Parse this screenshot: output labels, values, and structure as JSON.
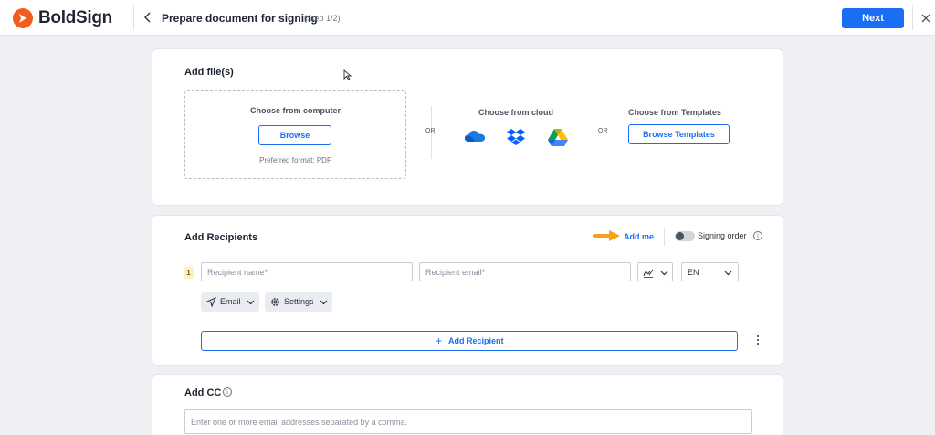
{
  "header": {
    "brand": "BoldSign",
    "title": "Prepare document for signing",
    "step": "(Step 1/2)",
    "next_label": "Next"
  },
  "files": {
    "title": "Add file(s)",
    "computer_title": "Choose from computer",
    "browse_label": "Browse",
    "preferred_format": "Preferred format: PDF",
    "or_label": "OR",
    "cloud_title": "Choose from cloud",
    "cloud_services": [
      "onedrive-icon",
      "dropbox-icon",
      "google-drive-icon"
    ],
    "templates_title": "Choose from Templates",
    "browse_templates_label": "Browse Templates"
  },
  "recipients": {
    "title": "Add Recipients",
    "add_me_label": "Add me",
    "signing_order_label": "Signing order",
    "signing_order_enabled": false,
    "rows": [
      {
        "number": "1",
        "name_placeholder": "Recipient name*",
        "email_placeholder": "Recipient email*",
        "role_icon": "signer-icon",
        "language": "EN",
        "delivery_label": "Email",
        "settings_label": "Settings"
      }
    ],
    "add_recipient_label": "Add Recipient"
  },
  "cc": {
    "title": "Add CC",
    "placeholder": "Enter one or more email addresses separated by a comma."
  },
  "colors": {
    "accent": "#1a6ef5",
    "brand": "#f25c1e",
    "annotation_arrow": "#f5a31a"
  }
}
